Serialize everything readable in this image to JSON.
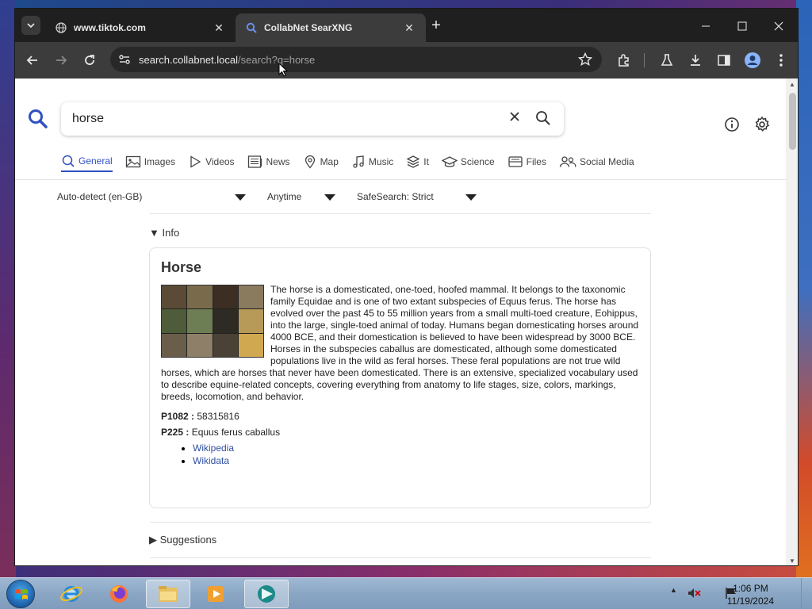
{
  "browser": {
    "tabs": [
      {
        "title": "www.tiktok.com",
        "active": false
      },
      {
        "title": "CollabNet SearXNG",
        "active": true
      }
    ],
    "url_host": "search.collabnet.local",
    "url_path": "/search?q=horse"
  },
  "search": {
    "query": "horse",
    "categories": [
      "General",
      "Images",
      "Videos",
      "News",
      "Map",
      "Music",
      "It",
      "Science",
      "Files",
      "Social Media"
    ],
    "active_category": "General",
    "filters": {
      "language": "Auto-detect (en-GB)",
      "time": "Anytime",
      "safesearch": "SafeSearch: Strict"
    }
  },
  "infobox": {
    "toggle_label": "Info",
    "title": "Horse",
    "description": "The horse is a domesticated, one-toed, hoofed mammal. It belongs to the taxonomic family Equidae and is one of two extant subspecies of Equus ferus. The horse has evolved over the past 45 to 55 million years from a small multi-toed creature, Eohippus, into the large, single-toed animal of today. Humans began domesticating horses around 4000 BCE, and their domestication is believed to have been widespread by 3000 BCE. Horses in the subspecies caballus are domesticated, although some domesticated populations live in the wild as feral horses. These feral populations are not true wild horses, which are horses that never have been domesticated. There is an extensive, specialized vocabulary used to describe equine-related concepts, covering everything from anatomy to life stages, size, colors, markings, breeds, locomotion, and behavior.",
    "props": [
      {
        "key": "P1082 :",
        "value": "58315816"
      },
      {
        "key": "P225 :",
        "value": "Equus ferus caballus"
      }
    ],
    "links": [
      "Wikipedia",
      "Wikidata"
    ]
  },
  "suggestions_label": "Suggestions",
  "taskbar": {
    "time": "1:06 PM",
    "date": "11/19/2024"
  },
  "colors": {
    "accent": "#3050c0",
    "link": "#3050a0",
    "chrome_dark": "#1f1f1f",
    "toolbar": "#3c3c3c"
  }
}
